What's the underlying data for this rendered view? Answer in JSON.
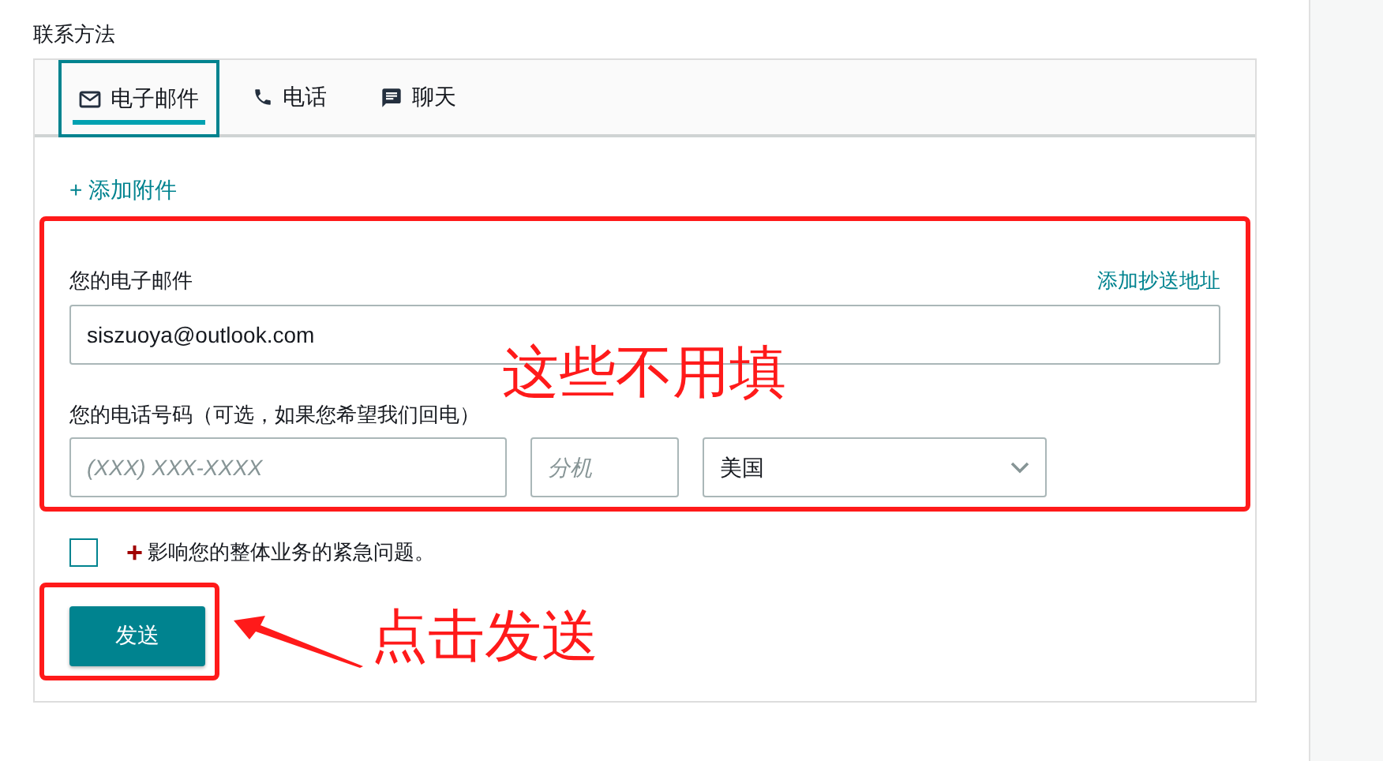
{
  "section_title": "联系方法",
  "tabs": [
    {
      "kind": "email",
      "label": "电子邮件",
      "selected": true
    },
    {
      "kind": "phone",
      "label": "电话",
      "selected": false
    },
    {
      "kind": "chat",
      "label": "聊天",
      "selected": false
    }
  ],
  "attach_link": "+ 添加附件",
  "email": {
    "label": "您的电子邮件",
    "cc_link": "添加抄送地址",
    "value": "siszuoya@outlook.com"
  },
  "phone": {
    "label": "您的电话号码（可选，如果您希望我们回电）",
    "number_placeholder": "(XXX) XXX-XXXX",
    "extension_placeholder": "分机",
    "country": "美国"
  },
  "urgent": {
    "checked": false,
    "mark": "+",
    "text": "影响您的整体业务的紧急问题。"
  },
  "send_button": "发送",
  "annotations": [
    {
      "text": "这些不用填"
    },
    {
      "text": "点击发送"
    }
  ]
}
